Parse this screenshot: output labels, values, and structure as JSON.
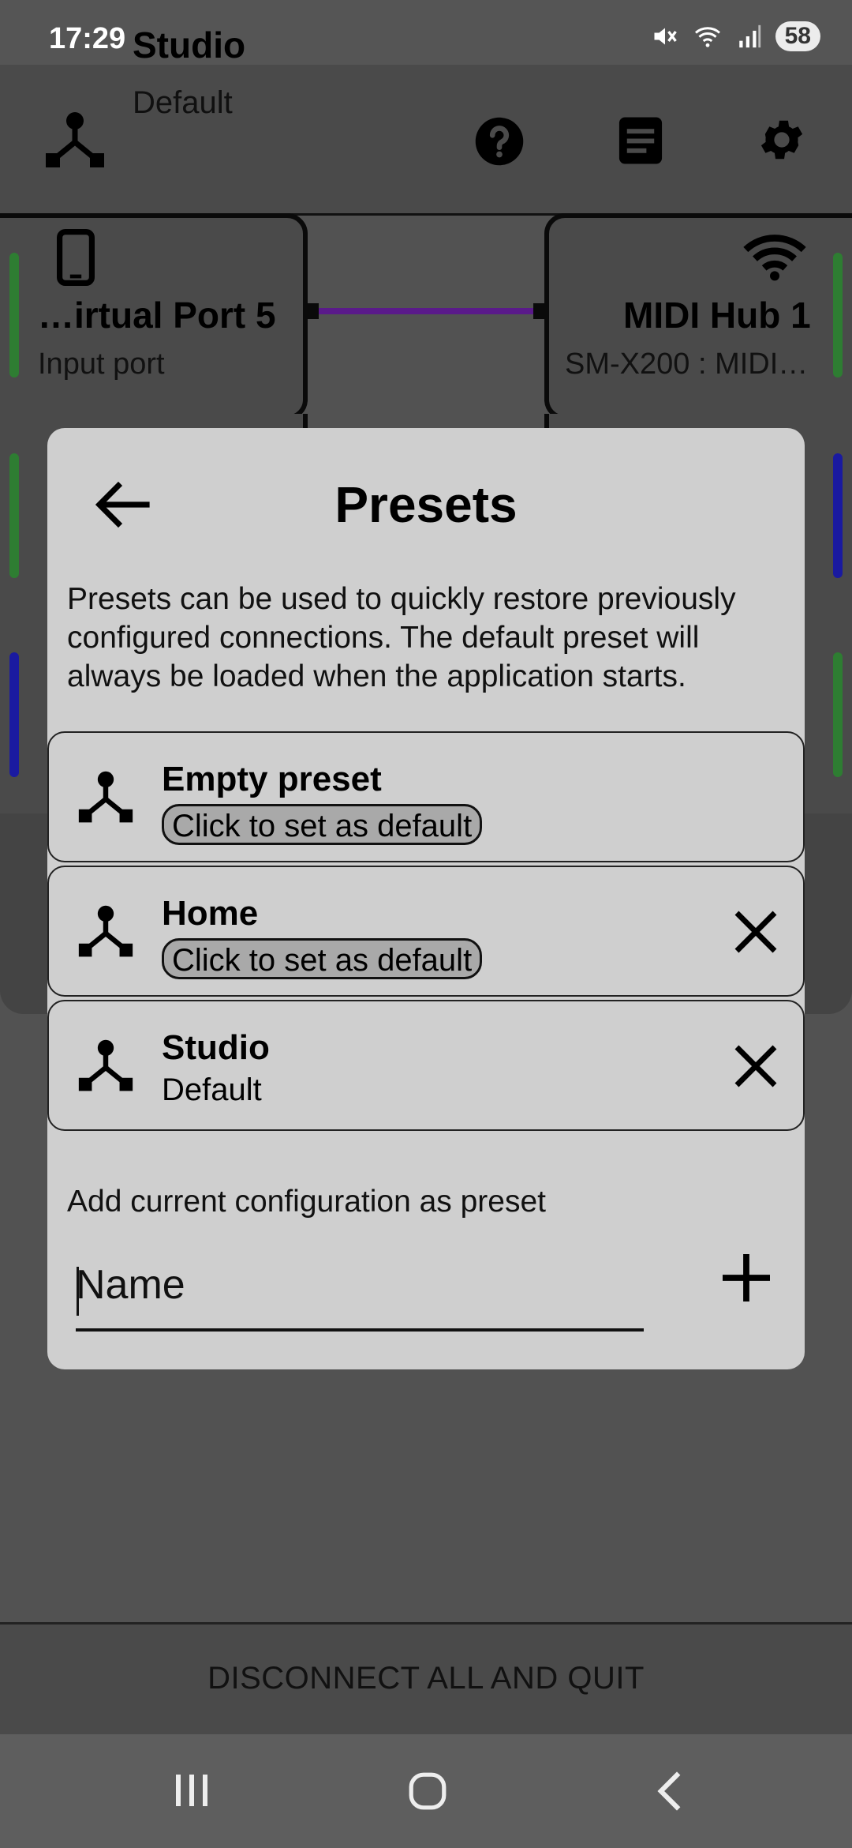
{
  "status": {
    "time": "17:29",
    "battery": "58"
  },
  "appbar": {
    "title": "Studio",
    "subtitle": "Default"
  },
  "ports": {
    "left": {
      "title": "…irtual Port 5",
      "subtitle": "Input port"
    },
    "right": {
      "title": "MIDI Hub 1",
      "subtitle": "SM-X200 : MIDI…"
    }
  },
  "dialog": {
    "title": "Presets",
    "description": "Presets can be used to quickly restore previously configured connections. The default preset will always be loaded when the application starts.",
    "presets": [
      {
        "name": "Empty preset",
        "status": "Click to set as default",
        "deletable": false
      },
      {
        "name": "Home",
        "status": "Click to set as default",
        "deletable": true
      },
      {
        "name": "Studio",
        "status": "Default",
        "deletable": true
      }
    ],
    "add_label": "Add current configuration as preset",
    "name_placeholder": "Name"
  },
  "bottom": {
    "disconnect_label": "DISCONNECT ALL AND QUIT"
  },
  "colors": {
    "connection_line": "#5a1a8a",
    "green_indicator": "#2e7d32",
    "blue_indicator": "#1a1aa0"
  }
}
